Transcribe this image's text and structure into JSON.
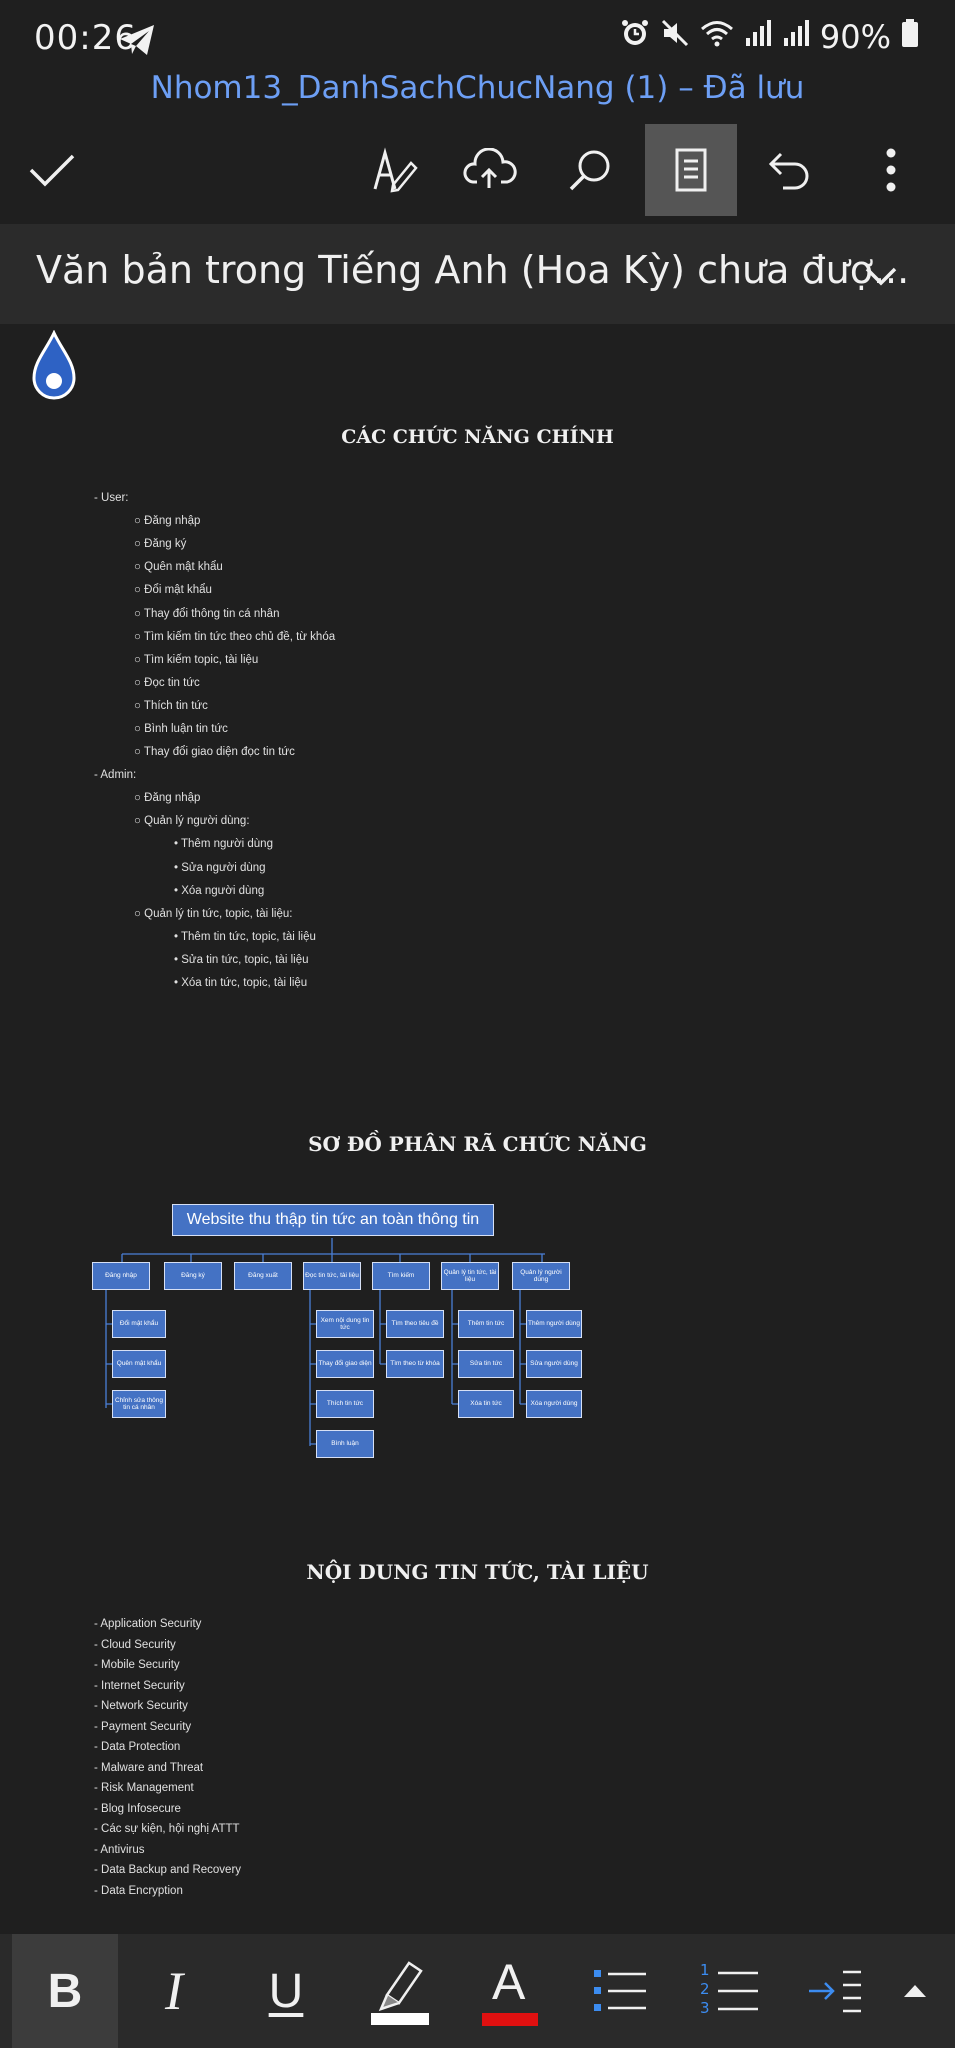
{
  "status_bar": {
    "time": "00:26",
    "battery": "90%"
  },
  "document_title": "Nhom13_DanhSachChucNang (1) – Đã lưu",
  "toolbar": {
    "icons": [
      "check-icon",
      "pen-icon",
      "cloud-upload-icon",
      "search-icon",
      "reading-view-icon",
      "undo-icon",
      "more-icon"
    ]
  },
  "notice": {
    "text": "Văn bản trong Tiếng Anh (Hoa Kỳ) chưa đượ..."
  },
  "section1": {
    "heading": "CÁC CHỨC NĂNG CHÍNH",
    "lines": [
      "- User:",
      "○ Đăng nhập",
      "○ Đăng ký",
      "○ Quên mật khẩu",
      "○ Đổi mật khẩu",
      "○ Thay đổi thông tin cá nhân",
      "○ Tìm kiếm tin tức theo chủ đề, từ khóa",
      "○ Tìm kiếm topic, tài liệu",
      "○ Đọc tin tức",
      "○ Thích tin tức",
      "○ Bình luận tin tức",
      "○ Thay đổi giao diện đọc tin tức",
      "- Admin:",
      "○ Đăng nhập",
      "○ Quản lý người dùng:",
      "• Thêm người dùng",
      "• Sửa người dùng",
      "• Xóa người dùng",
      "○ Quản lý tin tức, topic, tài liệu:",
      "• Thêm tin tức, topic, tài liệu",
      "• Sửa tin tức, topic, tài liệu",
      "• Xóa tin tức, topic, tài liệu"
    ]
  },
  "section2": {
    "heading": "SƠ ĐỒ PHÂN RÃ CHỨC NĂNG",
    "root": "Website thu thập tin tức an toàn thông tin",
    "level1": [
      "Đăng nhập",
      "Đăng ký",
      "Đăng xuất",
      "Đọc tin tức, tài liệu",
      "Tìm kiếm",
      "Quản lý tin tức, tài liệu",
      "Quản lý người dùng"
    ],
    "children": {
      "dang_nhap": [
        "Đổi mật khẩu",
        "Quên mật khẩu",
        "Chỉnh sửa thông tin cá nhân"
      ],
      "doc_tin": [
        "Xem nội dung tin tức",
        "Thay đổi giao diện",
        "Thích tin tức",
        "Bình luận"
      ],
      "tim_kiem": [
        "Tìm theo tiêu đề",
        "Tìm theo từ khóa"
      ],
      "ql_tin": [
        "Thêm tin tức",
        "Sửa tin tức",
        "Xóa tin tức"
      ],
      "ql_nguoi": [
        "Thêm người dùng",
        "Sửa người dùng",
        "Xóa người dùng"
      ]
    }
  },
  "section3": {
    "heading": "NỘI DUNG TIN TỨC, TÀI LIỆU",
    "lines": [
      "- Application Security",
      "- Cloud Security",
      "- Mobile Security",
      "- Internet Security",
      "- Network Security",
      "- Payment Security",
      "- Data Protection",
      "- Malware and Threat",
      "- Risk Management",
      "- Blog Infosecure",
      "- Các sự kiện, hội nghị ATTT",
      "- Antivirus",
      "- Data Backup and Recovery",
      "- Data Encryption"
    ]
  },
  "format_bar": {
    "bold": "B",
    "italic": "I",
    "underline": "U",
    "font_color_letter": "A",
    "highlight_color": "#ffffff",
    "font_color": "#e01010",
    "numbered_digits": [
      "1",
      "2",
      "3"
    ]
  }
}
